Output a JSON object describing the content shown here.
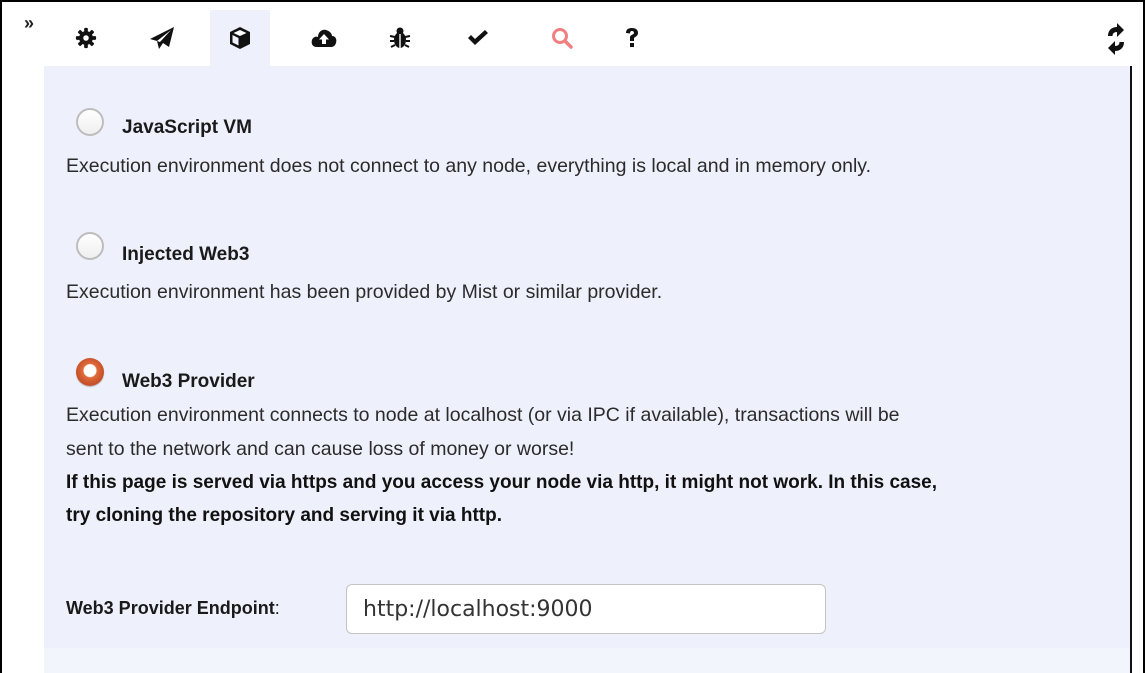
{
  "toolbar": {
    "collapse_glyph": "»",
    "tabs": [
      {
        "icon": "gear-icon",
        "active": false
      },
      {
        "icon": "paper-plane-icon",
        "active": false
      },
      {
        "icon": "cube-icon",
        "active": true
      },
      {
        "icon": "cloud-upload-icon",
        "active": false
      },
      {
        "icon": "bug-icon",
        "active": false
      },
      {
        "icon": "checkmark-icon",
        "active": false
      },
      {
        "icon": "search-icon",
        "active": false
      },
      {
        "icon": "question-icon",
        "active": false
      }
    ],
    "refresh_icon": "refresh-icon"
  },
  "environment": {
    "options": [
      {
        "label": "JavaScript VM",
        "selected": false,
        "description": [
          "Execution environment does not connect to any node, everything is local and in memory only."
        ]
      },
      {
        "label": "Injected Web3",
        "selected": false,
        "description": [
          "Execution environment has been provided by Mist or similar provider."
        ]
      },
      {
        "label": "Web3 Provider",
        "selected": true,
        "description": [
          "Execution environment connects to node at localhost (or via IPC if available), transactions will be",
          "sent to the network and can cause loss of money or worse!"
        ],
        "warning": [
          "If this page is served via https and you access your node via http, it might not work. In this case,",
          "try cloning the repository and serving it via http."
        ]
      }
    ],
    "endpoint": {
      "label": "Web3 Provider Endpoint",
      "colon": ":",
      "value": "http://localhost:9000"
    }
  },
  "colors": {
    "panel_bg": "#eef1fb",
    "active_tab_bg": "#eef1fc",
    "radio_selected": "#e06b3a",
    "search_icon": "#f08080"
  }
}
